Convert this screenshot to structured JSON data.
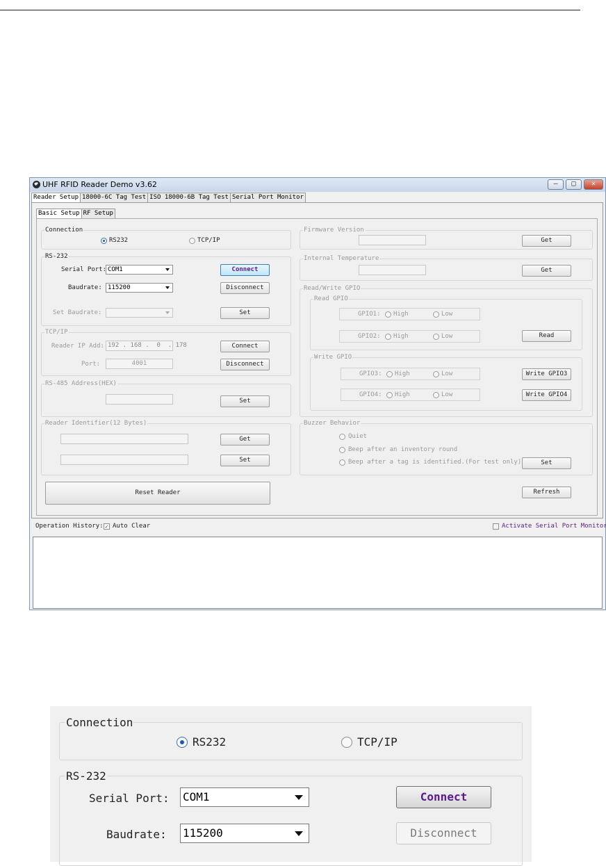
{
  "window": {
    "title": "UHF RFID Reader Demo v3.62",
    "minimize": "–",
    "maximize": "□",
    "close": "✕",
    "icon": "app-globe-icon"
  },
  "main_tabs": [
    "Reader Setup",
    "18000-6C Tag Test",
    "ISO 18000-6B Tag Test",
    "Serial Port Monitor"
  ],
  "sub_tabs": [
    "Basic Setup",
    "RF Setup"
  ],
  "connection": {
    "title": "Connection",
    "option_rs232": "RS232",
    "option_tcpip": "TCP/IP",
    "selected": "RS232"
  },
  "rs232": {
    "title": "RS-232",
    "serial_port_label": "Serial Port:",
    "serial_port_value": "COM1",
    "baudrate_label": "Baudrate:",
    "baudrate_value": "115200",
    "connect": "Connect",
    "disconnect": "Disconnect",
    "set_baudrate_label": "Set Baudrate:",
    "set": "Set"
  },
  "tcpip": {
    "title": "TCP/IP",
    "ip_label": "Reader IP Add:",
    "ip": [
      "192",
      "168",
      "0",
      "178"
    ],
    "port_label": "Port:",
    "port": "4001",
    "connect": "Connect",
    "disconnect": "Disconnect"
  },
  "rs485": {
    "title": "RS-485 Address(HEX)",
    "set": "Set"
  },
  "identifier": {
    "title": "Reader Identifier(12 Bytes)",
    "get": "Get",
    "set": "Set"
  },
  "reset": "Reset Reader",
  "firmware": {
    "title": "Firmware Version",
    "get": "Get"
  },
  "temperature": {
    "title": "Internal Temperature",
    "get": "Get"
  },
  "gpio": {
    "title": "Read/Write GPIO",
    "read_title": "Read GPIO",
    "write_title": "Write GPIO",
    "gpio1": "GPIO1:",
    "gpio2": "GPIO2:",
    "gpio3": "GPIO3:",
    "gpio4": "GPIO4:",
    "high": "High",
    "low": "Low",
    "read": "Read",
    "write3": "Write GPIO3",
    "write4": "Write GPIO4"
  },
  "buzzer": {
    "title": "Buzzer Behavior",
    "quiet": "Quiet",
    "after_round": "Beep after an inventory round",
    "after_tag": "Beep after a tag is identified.(For test only)",
    "set": "Set"
  },
  "refresh": "Refresh",
  "history": {
    "label": "Operation History:",
    "auto_clear": "Auto Clear",
    "auto_clear_checked": true,
    "activate_monitor": "Activate Serial Port Monitor",
    "activate_checked": false
  },
  "check_mark": "✓",
  "zoom": {
    "connection_title": "Connection",
    "rs232": "RS232",
    "tcpip": "TCP/IP",
    "rs232_title": "RS-232",
    "serial_port_label": "Serial Port:",
    "serial_port_value": "COM1",
    "baudrate_label": "Baudrate:",
    "baudrate_value": "115200",
    "connect": "Connect",
    "disconnect": "Disconnect"
  }
}
